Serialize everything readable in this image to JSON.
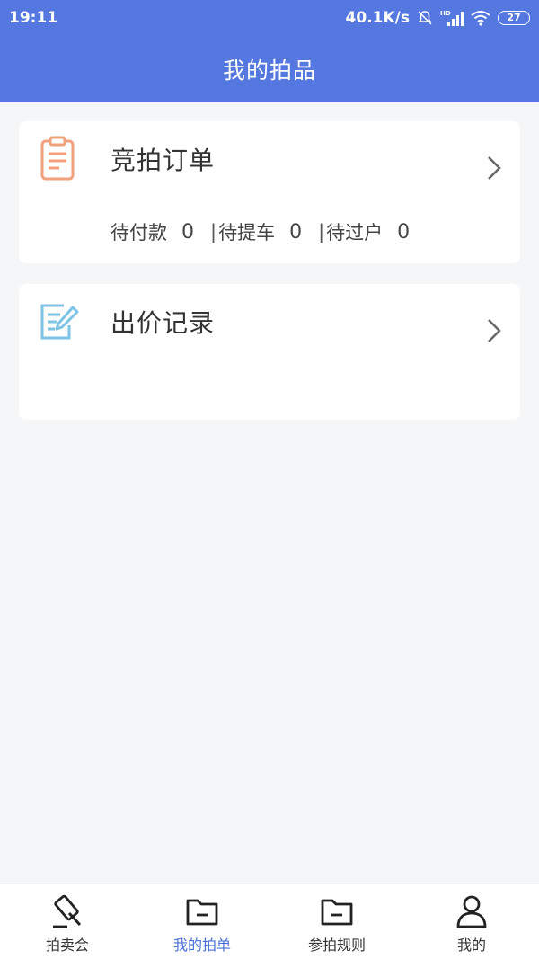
{
  "status_bar": {
    "time": "19:11",
    "network_speed": "40.1K/s",
    "battery": "27",
    "icons": [
      "mute-icon",
      "hd-signal-icon",
      "wifi-icon",
      "battery-icon"
    ]
  },
  "header": {
    "title": "我的拍品"
  },
  "orders_card": {
    "title": "竞拍订单",
    "icon": "clipboard-icon",
    "stats": [
      {
        "label": "待付款",
        "count": "0"
      },
      {
        "label": "待提车",
        "count": "0"
      },
      {
        "label": "待过户",
        "count": "0"
      }
    ]
  },
  "bids_card": {
    "title": "出价记录",
    "icon": "edit-record-icon"
  },
  "nav": {
    "items": [
      {
        "label": "拍卖会",
        "icon": "gavel-icon",
        "active": false
      },
      {
        "label": "我的拍单",
        "icon": "folder-icon",
        "active": true
      },
      {
        "label": "参拍规则",
        "icon": "folder-icon",
        "active": false
      },
      {
        "label": "我的",
        "icon": "person-icon",
        "active": false
      }
    ]
  },
  "colors": {
    "primary": "#5477e0",
    "active_nav": "#4a6fd8",
    "orders_icon": "#f2a17d",
    "bids_icon": "#7cc3e6",
    "background": "#f5f6f8"
  }
}
